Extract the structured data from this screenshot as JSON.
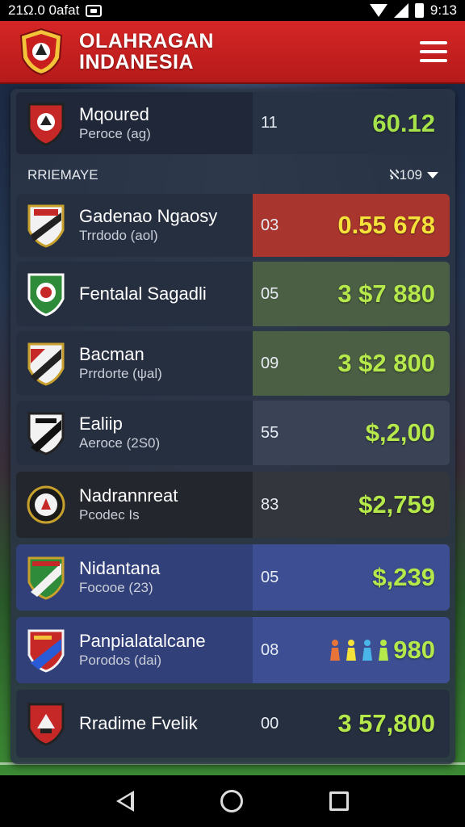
{
  "status_bar": {
    "left_text": "21Ω.0 0afat",
    "time": "9:13"
  },
  "header": {
    "title_line1": "OLAHRAGAN",
    "title_line2": "INDANESIA"
  },
  "featured": {
    "name": "Mqoured",
    "sub": "Peroce (ag)",
    "rank": "11",
    "value": "60.12",
    "value_color": "#a6e34a"
  },
  "section": {
    "label": "RRIEMAYE",
    "sort_label": "ℵ109"
  },
  "rows": [
    {
      "name": "Gadenao Ngaosy",
      "sub": "Trrdodo (aol)",
      "rank": "03",
      "value": "0.55 678",
      "value_color": "#f4e13a",
      "bg": "#a8362e"
    },
    {
      "name": "Fentalal Sagadli",
      "sub": "",
      "rank": "05",
      "value": "3 $7 880",
      "value_color": "#b5e84a",
      "bg": "#4b5f44"
    },
    {
      "name": "Bacman",
      "sub": "Prrdorte (ψal)",
      "rank": "09",
      "value": "3 $2 800",
      "value_color": "#b5e84a",
      "bg": "#4b5f44"
    },
    {
      "name": "Ealiip",
      "sub": "Aeroce (2S0)",
      "rank": "55",
      "value": "$,2,00",
      "value_color": "#b5e84a",
      "bg": "#3a4356"
    },
    {
      "name": "Nadrannreat",
      "sub": "Pcodec Is",
      "rank": "83",
      "value": "$2,759",
      "value_color": "#b5e84a",
      "bg": "#33363c"
    },
    {
      "name": "Nidantana",
      "sub": "Focooe (23)",
      "rank": "05",
      "value": "$,239",
      "value_color": "#b5e84a",
      "bg": "#3d4f92"
    },
    {
      "name": "Panpialatalcane",
      "sub": "Porodos (dai)",
      "rank": "08",
      "value": "980",
      "value_color": "#b5e84a",
      "bg": "#3d4f92"
    },
    {
      "name": "Rradime Fvelik",
      "sub": "",
      "rank": "00",
      "value": "3 57,800",
      "value_color": "#b5e84a",
      "bg": "#262f40"
    }
  ]
}
